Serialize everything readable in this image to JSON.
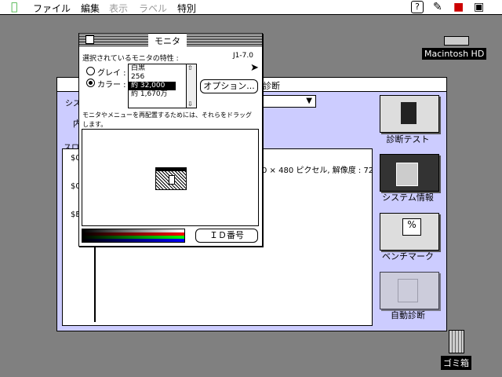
{
  "menubar": {
    "items": [
      "ファイル",
      "編集",
      "表示",
      "ラベル",
      "特別"
    ]
  },
  "desktop": {
    "hd_label": "Macintosh HD",
    "trash_label": "ゴミ箱"
  },
  "bgwindow": {
    "title_fragment": "診断",
    "label_sys": "シス",
    "label_in": "内",
    "label_slot": "スロ",
    "slot_rows": [
      "$0",
      "$0",
      "$E"
    ],
    "info_text": "0 × 480 ピクセル, 解像度 : 72",
    "buttons": [
      "診断テスト",
      "システム情報",
      "ベンチマーク",
      "自動診断"
    ]
  },
  "dialog": {
    "title": "モニタ",
    "characteristics_label": "選択されているモニタの特性 :",
    "version": "J1-7.0",
    "gray_label": "グレイ :",
    "color_label": "カラー :",
    "depth_options": [
      "白黒",
      "256",
      "約 32,000",
      "約 1,670万"
    ],
    "selected_index": 2,
    "options_button": "オプション...",
    "instruction": "モニタやメニューを再配置するためには、それらをドラッグします。",
    "id_button": "ＩＤ番号"
  }
}
